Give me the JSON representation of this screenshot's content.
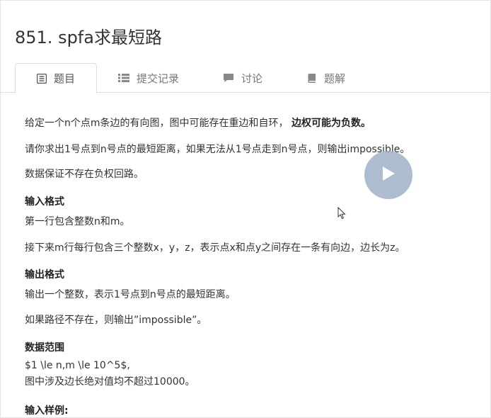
{
  "problem": {
    "title": "851. spfa求最短路"
  },
  "tabs": [
    {
      "label": "题目",
      "icon": "list-icon",
      "active": true
    },
    {
      "label": "提交记录",
      "icon": "list-bullets-icon",
      "active": false
    },
    {
      "label": "讨论",
      "icon": "comment-icon",
      "active": false
    },
    {
      "label": "题解",
      "icon": "book-icon",
      "active": false
    }
  ],
  "description": {
    "line1_normal": "给定一个n个点m条边的有向图，图中可能存在重边和自环，",
    "line1_bold": "边权可能为负数。",
    "line2": "请你求出1号点到n号点的最短距离，如果无法从1号点走到n号点，则输出impossible。",
    "line3": "数据保证不存在负权回路。"
  },
  "input_format": {
    "heading": "输入格式",
    "line1": "第一行包含整数n和m。",
    "line2": "接下来m行每行包含三个整数x，y，z，表示点x和点y之间存在一条有向边，边长为z。"
  },
  "output_format": {
    "heading": "输出格式",
    "line1": "输出一个整数，表示1号点到n号点的最短距离。",
    "line2": "如果路径不存在，则输出”impossible”。"
  },
  "data_range": {
    "heading": "数据范围",
    "line1": "$1 \\le n,m \\le 10^5$,",
    "line2": "图中涉及边长绝对值均不超过10000。"
  },
  "sample_input": {
    "heading": "输入样例:"
  },
  "colors": {
    "accent": "#a0b0c8",
    "text": "#333333",
    "tab_text": "#777777"
  }
}
